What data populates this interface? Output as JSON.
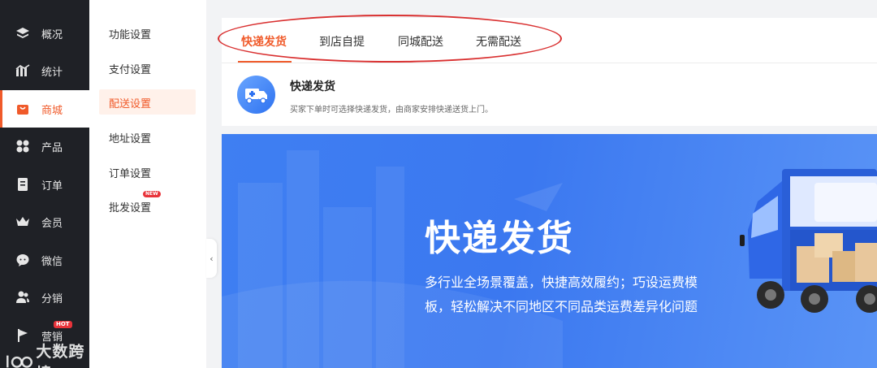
{
  "nav": {
    "items": [
      {
        "label": "概况",
        "icon": "layers-icon"
      },
      {
        "label": "统计",
        "icon": "chart-icon"
      },
      {
        "label": "商城",
        "icon": "shop-icon",
        "active": true
      },
      {
        "label": "产品",
        "icon": "grid-icon"
      },
      {
        "label": "订单",
        "icon": "order-icon"
      },
      {
        "label": "会员",
        "icon": "crown-icon"
      },
      {
        "label": "微信",
        "icon": "chat-icon"
      },
      {
        "label": "分销",
        "icon": "users-icon"
      },
      {
        "label": "营销",
        "icon": "flag-icon",
        "badge": "HOT"
      }
    ]
  },
  "submenu": {
    "items": [
      {
        "label": "功能设置"
      },
      {
        "label": "支付设置"
      },
      {
        "label": "配送设置",
        "active": true
      },
      {
        "label": "地址设置"
      },
      {
        "label": "订单设置"
      },
      {
        "label": "批发设置",
        "badge": "NEW"
      }
    ]
  },
  "tabs": [
    {
      "label": "快递发货",
      "active": true
    },
    {
      "label": "到店自提"
    },
    {
      "label": "同城配送"
    },
    {
      "label": "无需配送"
    }
  ],
  "info": {
    "title": "快递发货",
    "desc": "买家下单时可选择快递发货，由商家安排快递送货上门。"
  },
  "banner": {
    "title": "快递发货",
    "line1": "多行业全场景覆盖，快捷高效履约；巧设运费模",
    "line2": "板，轻松解决不同地区不同品类运费差异化问题"
  },
  "watermark": "大数跨境",
  "colors": {
    "accent": "#f05a2a",
    "sidebar": "#1f2126",
    "banner": "#3f7ff2",
    "annotation": "#d93030"
  }
}
